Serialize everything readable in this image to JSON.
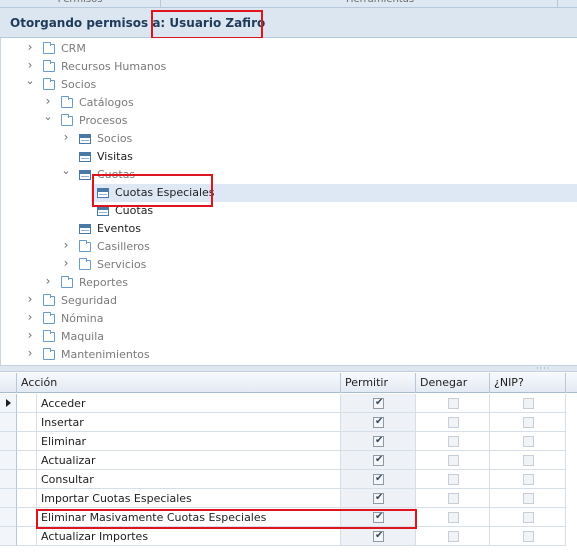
{
  "top_tabs": [
    "Permisos",
    "Herramientas"
  ],
  "header": {
    "prefix": "Otorgando permisos a: ",
    "user": "Usuario Zafiro"
  },
  "tree": [
    {
      "label": "CRM",
      "icon": "folder-icon",
      "expander": "collapsed",
      "tone": "grey"
    },
    {
      "label": "Recursos Humanos",
      "icon": "folder-icon",
      "expander": "collapsed",
      "tone": "grey"
    },
    {
      "label": "Socios",
      "icon": "folder-icon",
      "expander": "expanded",
      "tone": "grey"
    },
    {
      "label": "Catálogos",
      "icon": "folder-icon",
      "expander": "collapsed",
      "tone": "grey"
    },
    {
      "label": "Procesos",
      "icon": "folder-icon",
      "expander": "expanded",
      "tone": "grey"
    },
    {
      "label": "Socios",
      "icon": "form-icon",
      "expander": "collapsed",
      "tone": "grey"
    },
    {
      "label": "Visitas",
      "icon": "form-icon",
      "expander": "none",
      "tone": "dark"
    },
    {
      "label": "Cuotas",
      "icon": "form-icon",
      "expander": "expanded",
      "tone": "grey"
    },
    {
      "label": "Cuotas Especiales",
      "icon": "form-icon",
      "expander": "none",
      "tone": "dark",
      "selected": true
    },
    {
      "label": "Cuotas",
      "icon": "form-icon",
      "expander": "none",
      "tone": "dark"
    },
    {
      "label": "Eventos",
      "icon": "form-icon",
      "expander": "none",
      "tone": "dark"
    },
    {
      "label": "Casilleros",
      "icon": "folder-icon",
      "expander": "collapsed",
      "tone": "grey"
    },
    {
      "label": "Servicios",
      "icon": "folder-icon",
      "expander": "collapsed",
      "tone": "grey"
    },
    {
      "label": "Reportes",
      "icon": "folder-icon",
      "expander": "collapsed",
      "tone": "grey"
    },
    {
      "label": "Seguridad",
      "icon": "folder-icon",
      "expander": "collapsed",
      "tone": "grey"
    },
    {
      "label": "Nómina",
      "icon": "folder-icon",
      "expander": "collapsed",
      "tone": "grey"
    },
    {
      "label": "Maquila",
      "icon": "folder-icon",
      "expander": "collapsed",
      "tone": "grey"
    },
    {
      "label": "Mantenimientos",
      "icon": "folder-icon",
      "expander": "collapsed",
      "tone": "grey"
    }
  ],
  "grid": {
    "columns": [
      "Acción",
      "Permitir",
      "Denegar",
      "¿NIP?"
    ],
    "rows": [
      {
        "accion": "Acceder",
        "permitir": true,
        "denegar": false,
        "nip": false
      },
      {
        "accion": "Insertar",
        "permitir": true,
        "denegar": false,
        "nip": false
      },
      {
        "accion": "Eliminar",
        "permitir": true,
        "denegar": false,
        "nip": false
      },
      {
        "accion": "Actualizar",
        "permitir": true,
        "denegar": false,
        "nip": false
      },
      {
        "accion": "Consultar",
        "permitir": true,
        "denegar": false,
        "nip": false
      },
      {
        "accion": "Importar Cuotas Especiales",
        "permitir": true,
        "denegar": false,
        "nip": false
      },
      {
        "accion": "Eliminar Masivamente Cuotas Especiales",
        "permitir": true,
        "denegar": false,
        "nip": false
      },
      {
        "accion": "Actualizar Importes",
        "permitir": true,
        "denegar": false,
        "nip": false
      }
    ]
  },
  "colors": {
    "highlight": "#e0141e",
    "header_bg": "#dce6f1",
    "selection": "#dde8f4"
  }
}
